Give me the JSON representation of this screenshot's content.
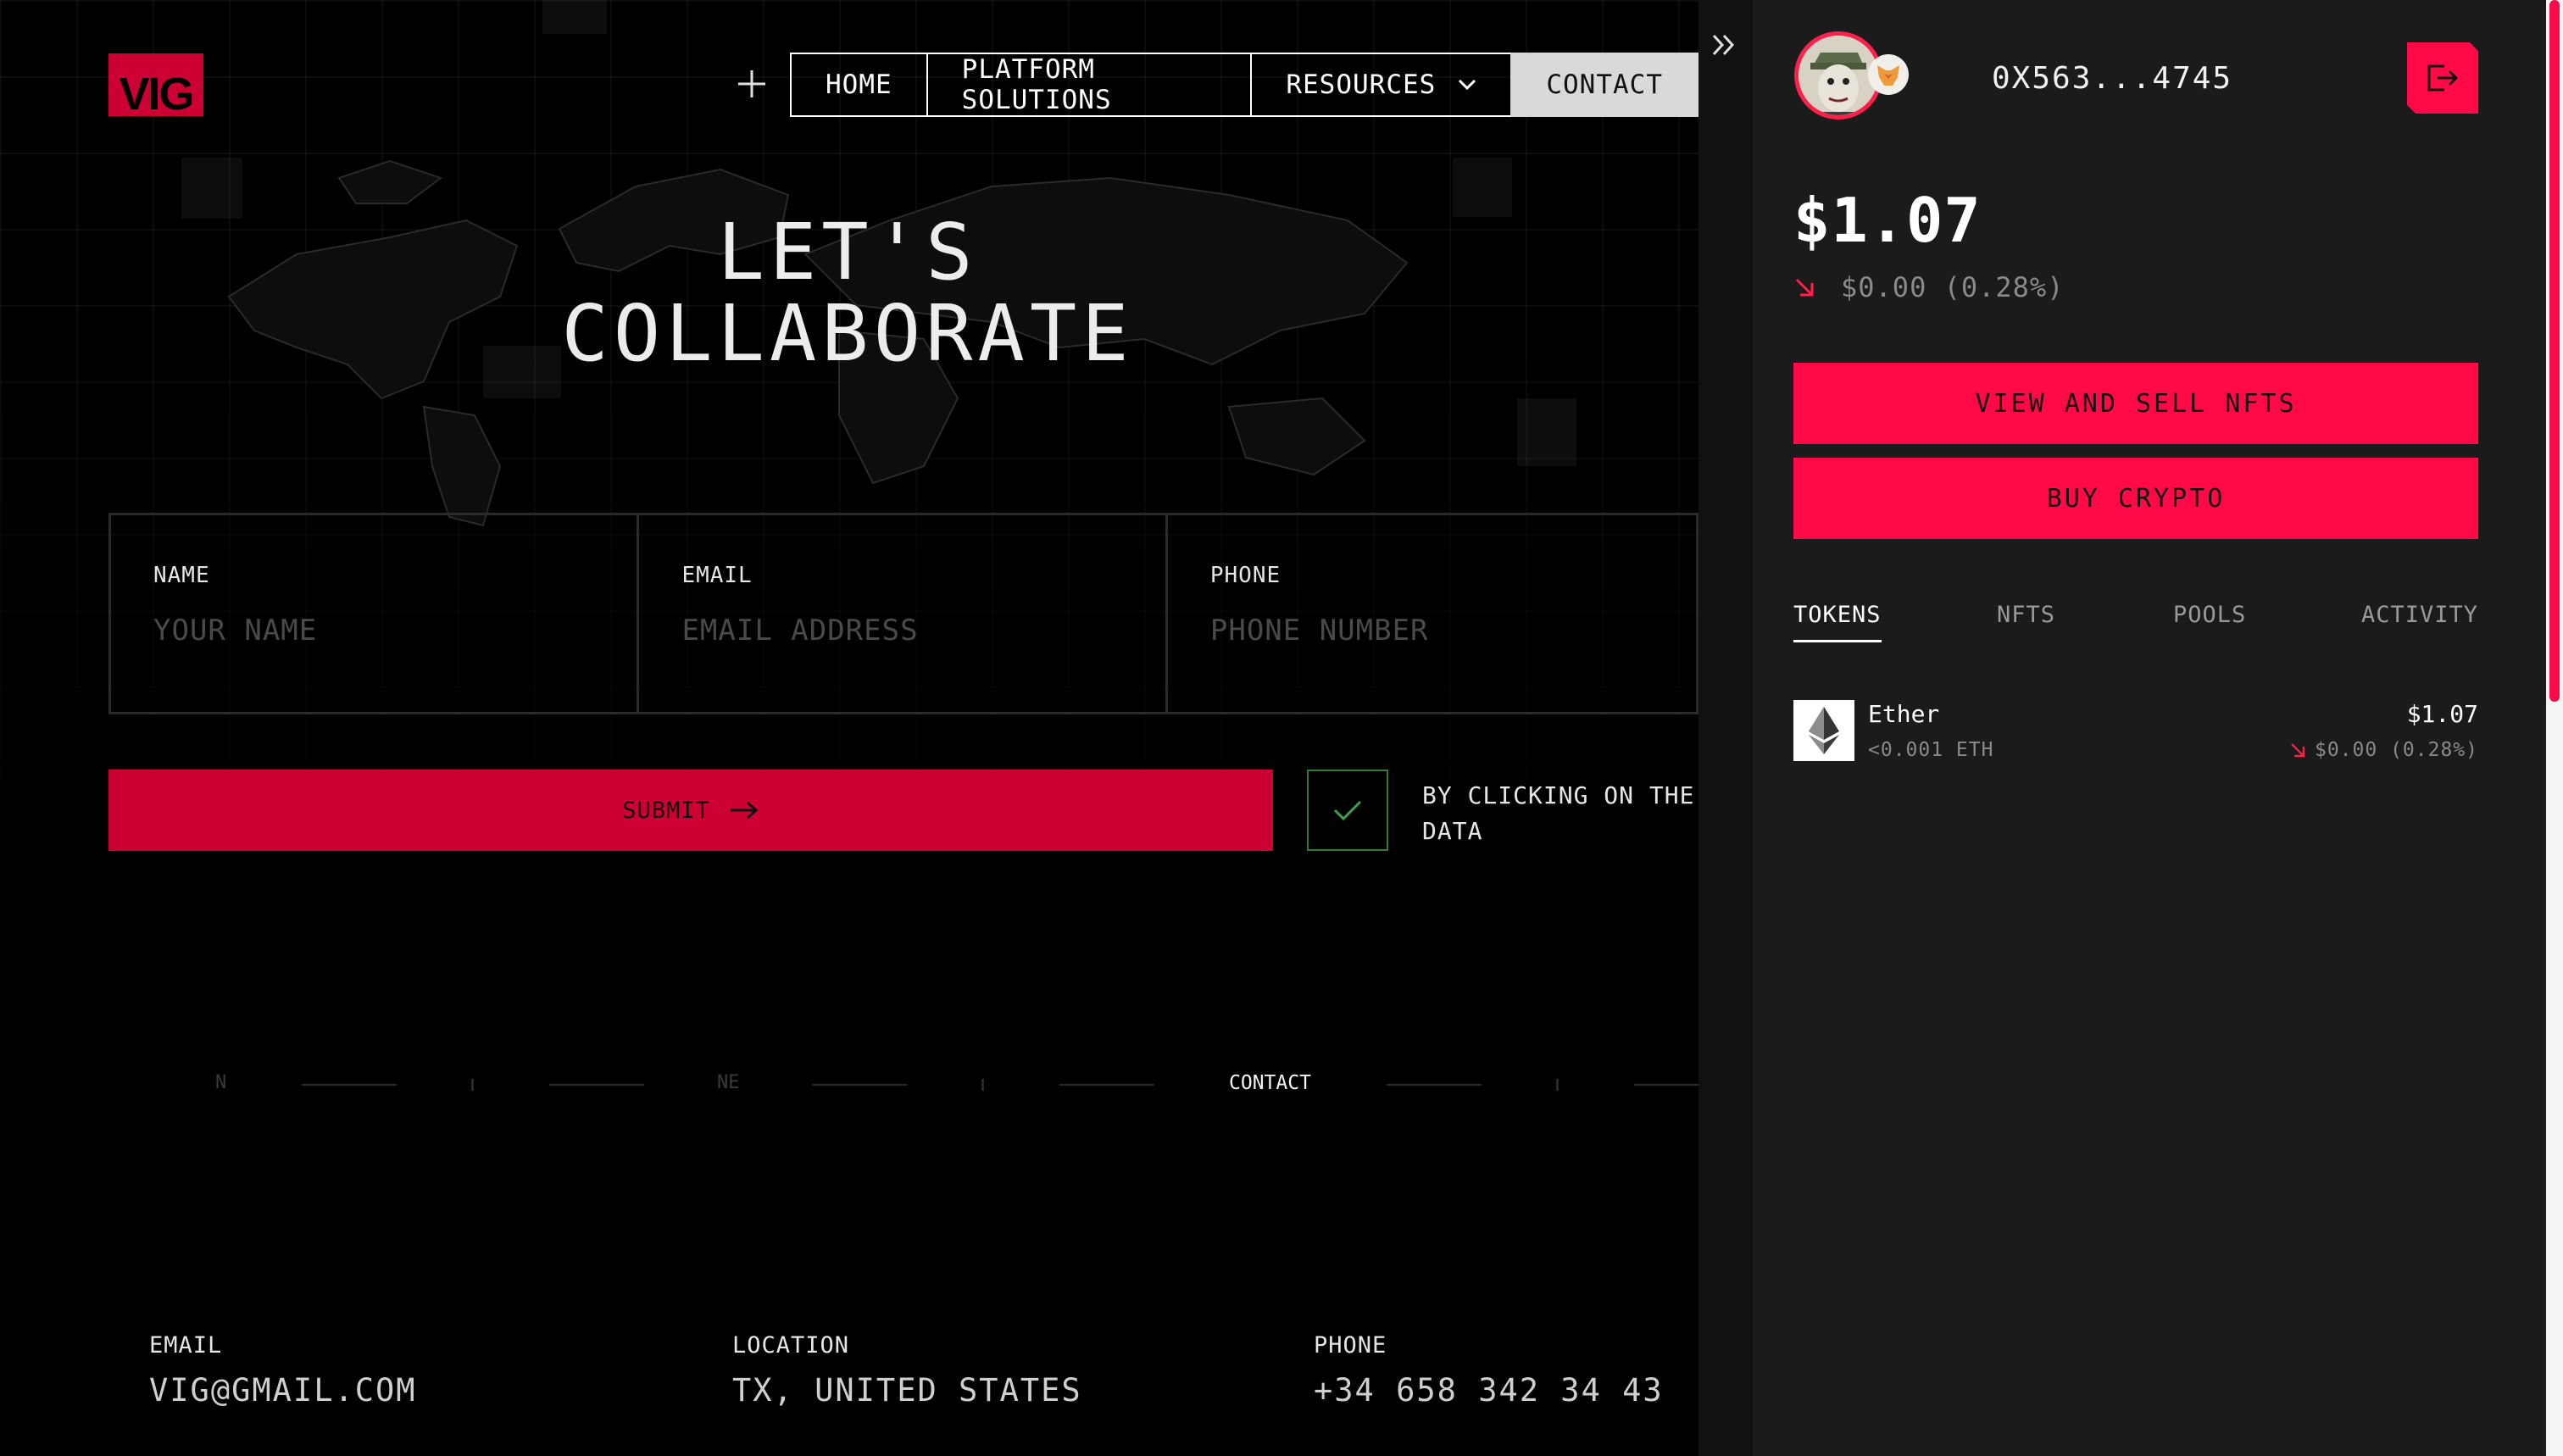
{
  "brand": {
    "logo_text": "VIG",
    "accent": "#ff0a47",
    "submit_color": "#cc0033"
  },
  "nav": {
    "items": [
      {
        "label": "HOME"
      },
      {
        "label": "PLATFORM SOLUTIONS"
      },
      {
        "label": "RESOURCES"
      },
      {
        "label": "CONTACT"
      }
    ]
  },
  "hero": {
    "line1": "LET'S",
    "line2": "COLLABORATE"
  },
  "form": {
    "fields": [
      {
        "label": "NAME",
        "placeholder": "YOUR NAME"
      },
      {
        "label": "EMAIL",
        "placeholder": "EMAIL ADDRESS"
      },
      {
        "label": "PHONE",
        "placeholder": "PHONE NUMBER"
      }
    ],
    "submit_label": "SUBMIT",
    "consent_checked": true,
    "consent_line1": "BY CLICKING ON THE BUTTO",
    "consent_line2": "DATA"
  },
  "compass": {
    "n": "N",
    "ne": "NE",
    "current": "CONTACT"
  },
  "footer": {
    "email_label": "EMAIL",
    "email_value": "VIG@GMAIL.COM",
    "location_label": "LOCATION",
    "location_value": "TX, UNITED STATES",
    "phone_label": "PHONE",
    "phone_value": "+34 658 342 34 43"
  },
  "wallet": {
    "address": "0X563...4745",
    "balance": "$1.07",
    "change": "$0.00 (0.28%)",
    "trend": "down",
    "buttons": {
      "view_sell": "VIEW AND SELL NFTS",
      "buy": "BUY CRYPTO"
    },
    "tabs": [
      {
        "label": "TOKENS"
      },
      {
        "label": "NFTS"
      },
      {
        "label": "POOLS"
      },
      {
        "label": "ACTIVITY"
      }
    ],
    "active_tab": "TOKENS",
    "tokens": [
      {
        "name": "Ether",
        "amount": "<0.001 ETH",
        "value": "$1.07",
        "change": "$0.00 (0.28%)",
        "icon": "ethereum-icon"
      }
    ]
  }
}
